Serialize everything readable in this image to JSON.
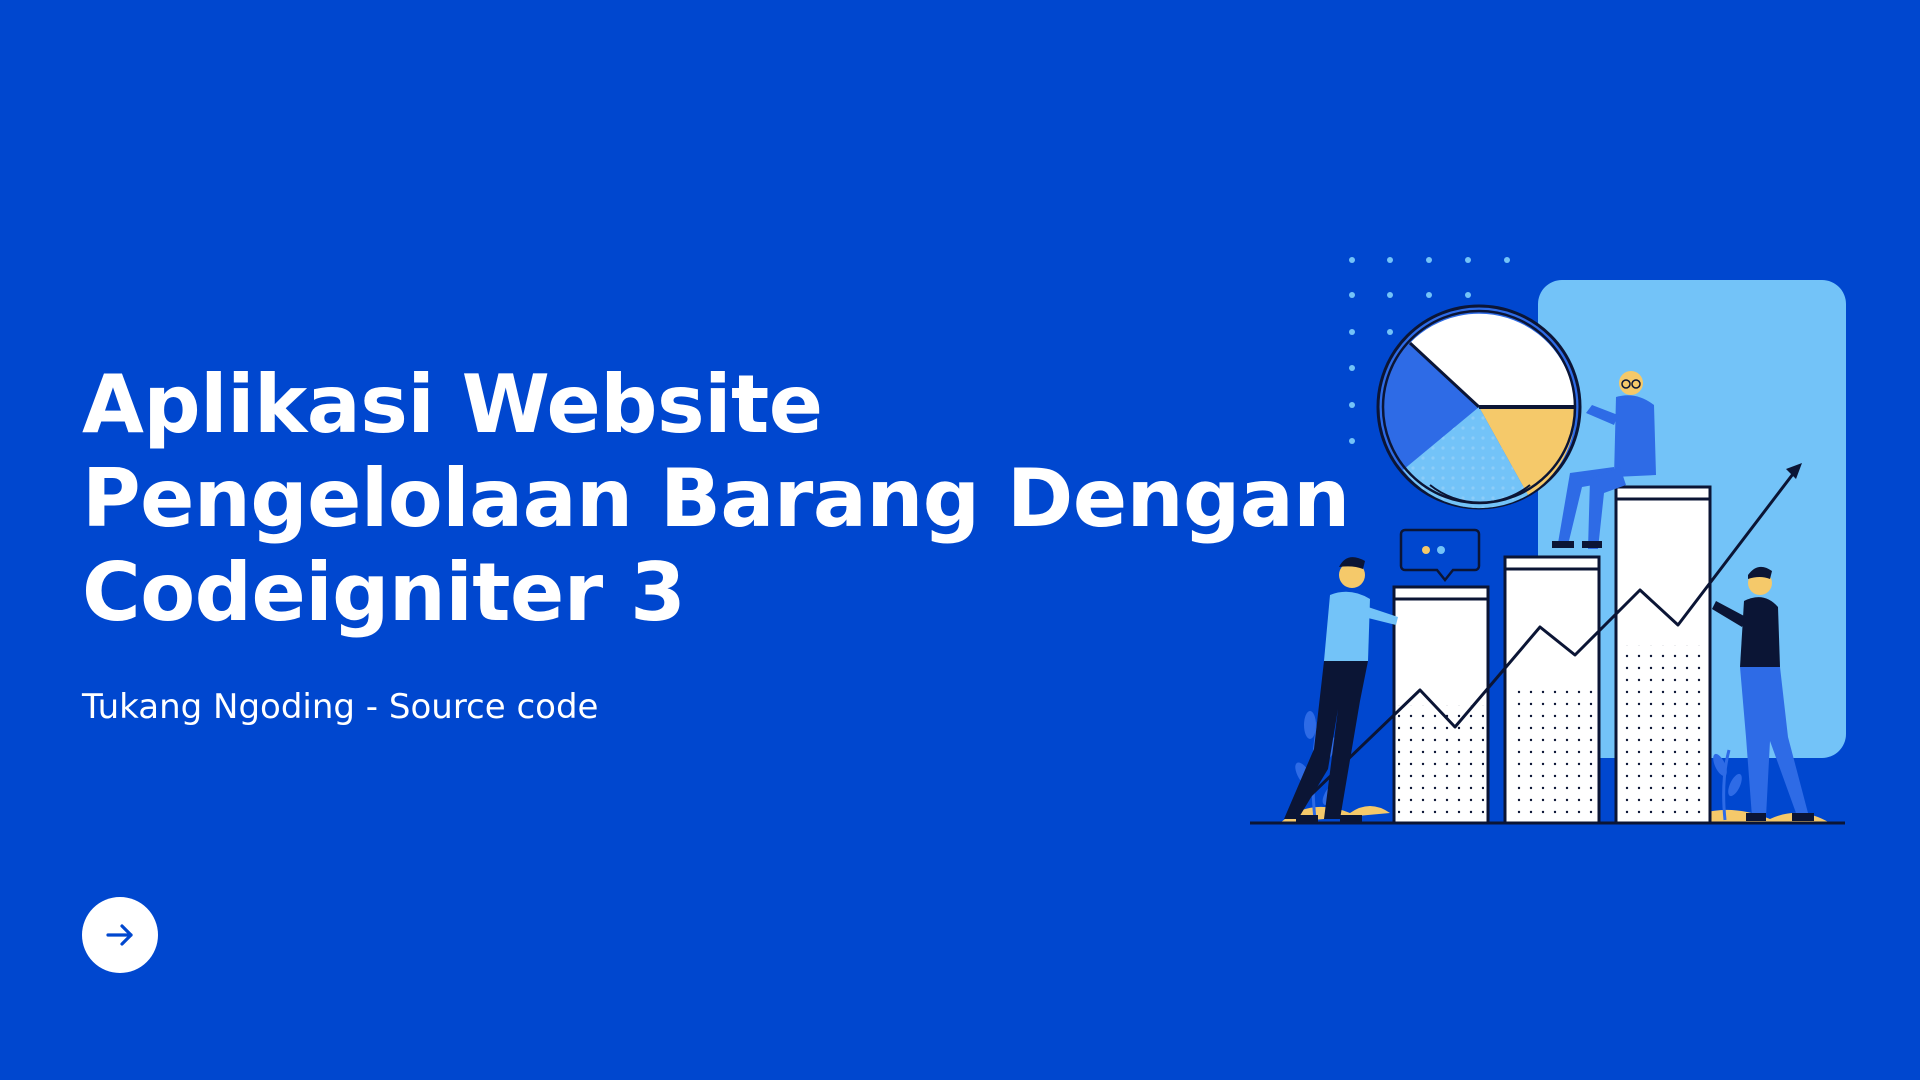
{
  "slide": {
    "title_lines": [
      "Aplikasi Website",
      "Pengelolaan Barang Dengan",
      "Codeigniter 3"
    ],
    "subtitle": "Tukang Ngoding - Source code",
    "next_icon": "arrow-right-icon",
    "illustration": "business-team-growth-chart"
  },
  "colors": {
    "background": "#0047CF",
    "text": "#FFFFFF",
    "light_blue": "#73C3F8",
    "mid_blue": "#2E6BE6",
    "yellow": "#F5C96A",
    "ink": "#0B1535"
  }
}
